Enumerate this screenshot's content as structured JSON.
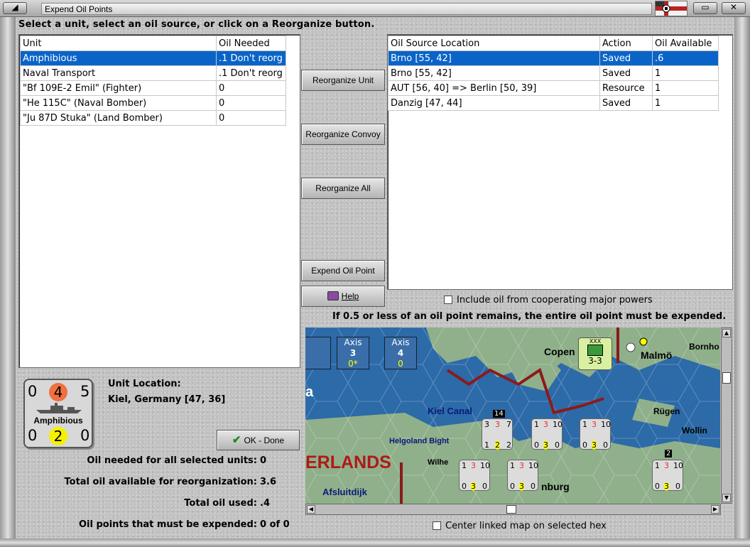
{
  "window": {
    "title": "Expend Oil Points"
  },
  "instruction": "Select a unit, select an oil source, or click on a Reorganize button.",
  "units_table": {
    "headers": [
      "Unit",
      "Oil Needed"
    ],
    "rows": [
      [
        "Amphibious",
        ".1 Don't reorg"
      ],
      [
        "Naval Transport",
        ".1 Don't reorg"
      ],
      [
        "\"Bf 109E-2 Emil\" (Fighter)",
        "0"
      ],
      [
        "\"He 115C\" (Naval Bomber)",
        "0"
      ],
      [
        "\"Ju 87D Stuka\" (Land Bomber)",
        "0"
      ]
    ],
    "selected_index": 0
  },
  "oil_table": {
    "headers": [
      "Oil Source Location",
      "Action",
      "Oil Available"
    ],
    "rows": [
      [
        "Brno [55, 42]",
        "Saved",
        ".6"
      ],
      [
        "Brno [55, 42]",
        "Saved",
        "1"
      ],
      [
        "AUT [56, 40] => Berlin [50, 39]",
        "Resource",
        "1"
      ],
      [
        "Danzig [47, 44]",
        "Saved",
        "1"
      ]
    ],
    "selected_index": 0
  },
  "buttons": {
    "reorganize_unit": "Reorganize Unit",
    "reorganize_convoy": "Reorganize Convoy",
    "reorganize_all": "Reorganize All",
    "expend_oil_point": "Expend Oil Point",
    "help": "Help",
    "ok_done": "OK - Done"
  },
  "include_oil_label": "Include oil from cooperating major powers",
  "rule_note": "If 0.5 or less of an oil point remains, the entire oil point must be expended.",
  "unit_counter": {
    "top_left": "0",
    "top_center": "4",
    "top_right": "5",
    "name": "Amphibious",
    "bottom_left": "0",
    "bottom_center": "2",
    "bottom_right": "0"
  },
  "unit_location": {
    "label": "Unit Location:",
    "value": "Kiel, Germany [47, 36]"
  },
  "stats": {
    "oil_needed_label": "Oil needed for all selected units:",
    "oil_needed_value": "0",
    "total_available_label": "Total oil available for reorganization:",
    "total_available_value": "3.6",
    "total_used_label": "Total oil used:",
    "total_used_value": ".4",
    "must_expend_label": "Oil points that must be expended:",
    "must_expend_value": "0 of 0"
  },
  "map": {
    "place_labels": [
      "Copen",
      "Malmö",
      "Bornho",
      "Kiel Canal",
      "Rügen",
      "Helgoland Bight",
      "Wollin",
      "ERLANDS",
      "Afsluitdijk",
      "nburg",
      "Wilhe",
      "a"
    ],
    "axis_boxes": [
      {
        "label": "Axis",
        "num": "3",
        "sub": "0*"
      },
      {
        "label": "Axis",
        "num": "4",
        "sub": "0"
      }
    ],
    "corps_counter": {
      "top": "XXX",
      "value": "3-3"
    },
    "stack_number_1": "14",
    "stack_number_2": "2"
  },
  "center_linked_label": "Center linked map on selected hex"
}
